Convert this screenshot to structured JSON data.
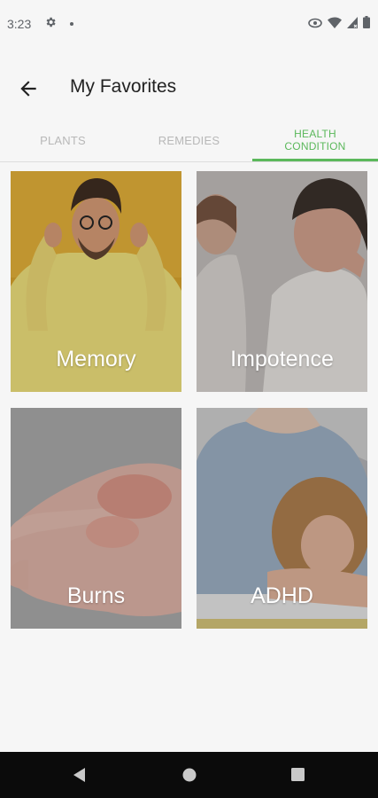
{
  "status": {
    "time": "3:23"
  },
  "header": {
    "title": "My Favorites"
  },
  "tabs": [
    {
      "label": "PLANTS",
      "active": false
    },
    {
      "label": "REMEDIES",
      "active": false
    },
    {
      "label": "HEALTH CONDITION",
      "active": true
    }
  ],
  "cards": [
    {
      "label": "Memory"
    },
    {
      "label": "Impotence"
    },
    {
      "label": "Burns"
    },
    {
      "label": "ADHD"
    }
  ],
  "colors": {
    "accent": "#5bb85b",
    "background": "#f6f6f6",
    "nav": "#0b0b0b"
  }
}
